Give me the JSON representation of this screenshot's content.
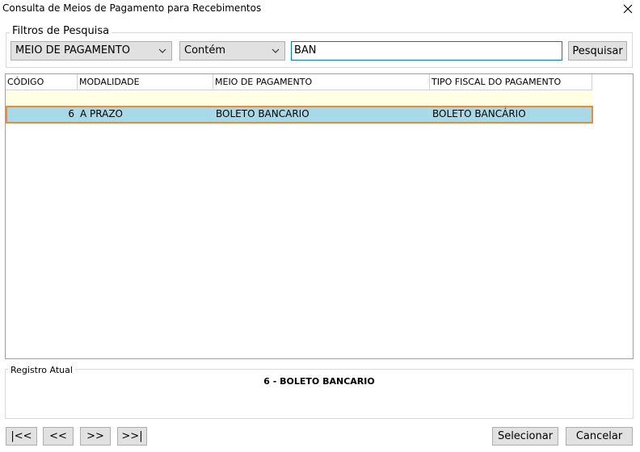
{
  "window": {
    "title": "Consulta de Meios de Pagamento para Recebimentos",
    "close_glyph": "✕"
  },
  "filters": {
    "legend": "Filtros de Pesquisa",
    "field_select": "MEIO DE PAGAMENTO",
    "operator_select": "Contém",
    "search_value": "BAN",
    "search_button": "Pesquisar"
  },
  "grid": {
    "columns": [
      "CÓDIGO",
      "MODALIDADE",
      "MEIO DE PAGAMENTO",
      "TIPO FISCAL DO PAGAMENTO"
    ],
    "rows": [
      {
        "codigo": "6",
        "modalidade": "A PRAZO",
        "meio": "BOLETO BANCARIO",
        "tipo_fiscal": "BOLETO BANCÁRIO"
      }
    ]
  },
  "current_record": {
    "legend": "Registro Atual",
    "value": "6 - BOLETO BANCARIO"
  },
  "navigation": {
    "first": "|<<",
    "prev": "<<",
    "next": ">>",
    "last": ">>|"
  },
  "actions": {
    "select": "Selecionar",
    "cancel": "Cancelar"
  },
  "colors": {
    "selected_row": "#a8d9e8",
    "selected_border": "#f08933",
    "new_row": "#ffffe4"
  },
  "icons": {
    "close": "close-icon",
    "dropdown": "chevron-down-icon"
  }
}
